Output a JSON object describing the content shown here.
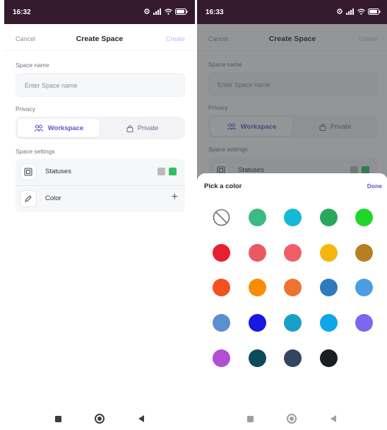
{
  "status_bar": {
    "left_time": "16:32",
    "right_time": "16:33",
    "battery": "79"
  },
  "form": {
    "cancel_label": "Cancel",
    "title": "Create Space",
    "create_label": "Create",
    "space_name_label": "Space name",
    "space_name_placeholder": "Enter Space name",
    "privacy_label": "Privacy",
    "privacy_options": [
      {
        "label": "Workspace",
        "icon": "people-icon",
        "selected": true
      },
      {
        "label": "Private",
        "icon": "lock-icon",
        "selected": false
      }
    ],
    "settings_label": "Space settings",
    "settings_rows": [
      {
        "label": "Statuses",
        "icon": "status-box-icon",
        "swatches": [
          "#b9bbbf",
          "#2fbf5f"
        ]
      },
      {
        "label": "Color",
        "icon": "pen-icon",
        "action": "+"
      }
    ]
  },
  "color_picker": {
    "title": "Pick a color",
    "done_label": "Done",
    "swatches": [
      {
        "color": "none",
        "icon": "no-color-icon"
      },
      {
        "color": "#3db983"
      },
      {
        "color": "#14b9d6"
      },
      {
        "color": "#27a85c"
      },
      {
        "color": "#1fd62a"
      },
      {
        "color": "#e81f2d"
      },
      {
        "color": "#ea5963"
      },
      {
        "color": "#f25e65"
      },
      {
        "color": "#f5b70e"
      },
      {
        "color": "#b5801f"
      },
      {
        "color": "#f4511e"
      },
      {
        "color": "#fb8c00"
      },
      {
        "color": "#ee7332"
      },
      {
        "color": "#2e7bbc"
      },
      {
        "color": "#4a9ee3"
      },
      {
        "color": "#5b8fcf"
      },
      {
        "color": "#1718e2"
      },
      {
        "color": "#1aa0c8"
      },
      {
        "color": "#0ea5e9"
      },
      {
        "color": "#7b68ee"
      },
      {
        "color": "#b14ed3"
      },
      {
        "color": "#0f4a5b"
      },
      {
        "color": "#34455e"
      },
      {
        "color": "#1c1d21"
      }
    ]
  },
  "colors": {
    "accent": "#5b53d9",
    "status_bar_bg": "#351a2e"
  }
}
